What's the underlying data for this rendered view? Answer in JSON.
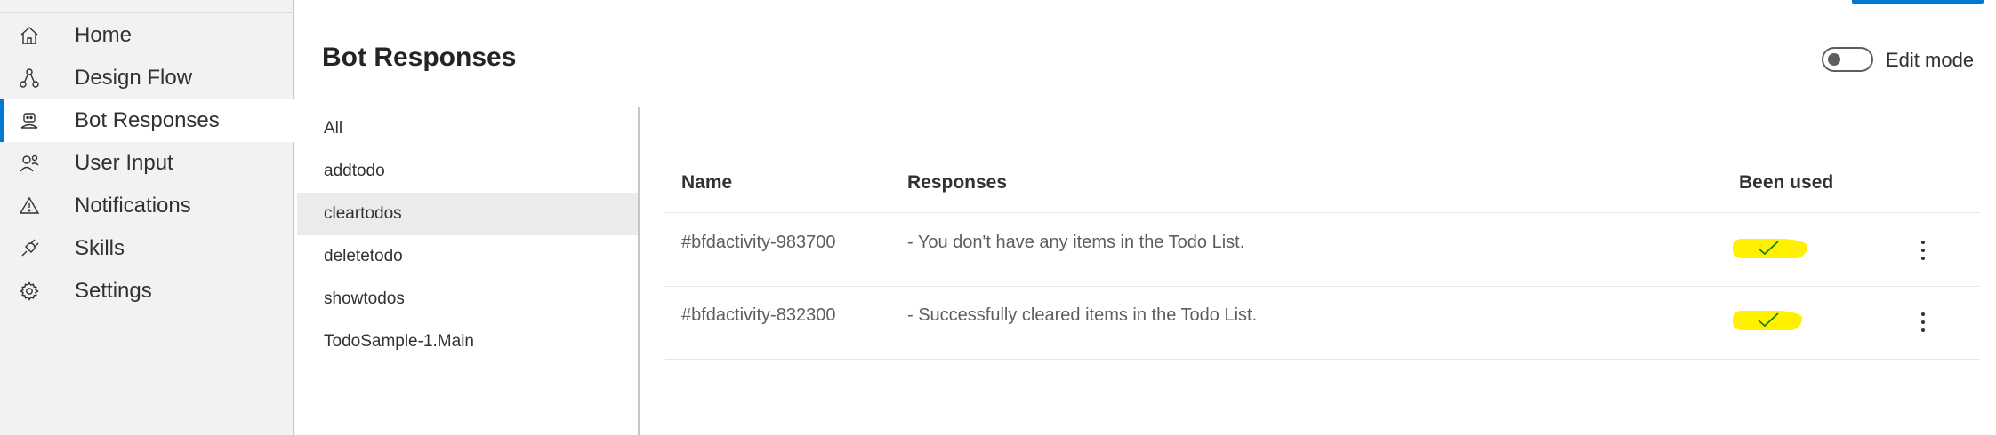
{
  "nav": {
    "items": [
      {
        "label": "Home",
        "icon": "home-icon"
      },
      {
        "label": "Design Flow",
        "icon": "flow-icon"
      },
      {
        "label": "Bot Responses",
        "icon": "bot-icon",
        "active": true
      },
      {
        "label": "User Input",
        "icon": "user-input-icon"
      },
      {
        "label": "Notifications",
        "icon": "warning-icon"
      },
      {
        "label": "Skills",
        "icon": "plug-icon"
      },
      {
        "label": "Settings",
        "icon": "gear-icon"
      }
    ]
  },
  "header": {
    "title": "Bot Responses",
    "edit_mode_label": "Edit mode",
    "edit_mode_on": false
  },
  "dialogs": {
    "items": [
      "All",
      "addtodo",
      "cleartodos",
      "deletetodo",
      "showtodos",
      "TodoSample-1.Main"
    ],
    "selected": "cleartodos"
  },
  "table": {
    "headers": {
      "name": "Name",
      "responses": "Responses",
      "used": "Been used"
    },
    "rows": [
      {
        "name": "#bfdactivity-983700",
        "response": "- You don't have any items in the Todo List.",
        "used": true
      },
      {
        "name": "#bfdactivity-832300",
        "response": "- Successfully cleared items in the Todo List.",
        "used": true
      }
    ]
  },
  "colors": {
    "accent": "#0078d4",
    "highlight": "#ffef00",
    "check": "#107c10",
    "nav_bg": "#f3f2f1"
  }
}
